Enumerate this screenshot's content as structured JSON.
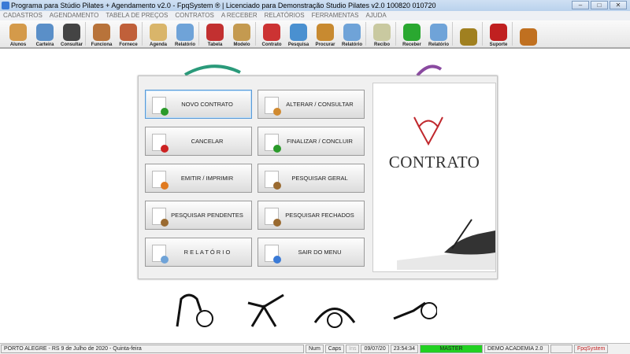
{
  "window": {
    "title": "Programa para Stúdio Pilates + Agendamento v2.0 - FpqSystem ® | Licenciado para  Demonstração Studio Pilates v2.0 100820 010720",
    "minimize": "–",
    "maximize": "□",
    "close": "✕"
  },
  "menu": [
    "CADASTROS",
    "AGENDAMENTO",
    "TABELA DE PREÇOS",
    "CONTRATOS",
    "A RECEBER",
    "RELATÓRIOS",
    "FERRAMENTAS",
    "AJUDA"
  ],
  "toolbar": [
    {
      "label": "Alunos",
      "color": "#d49a4a"
    },
    {
      "label": "Carteira",
      "color": "#5a8fc8"
    },
    {
      "label": "Consultar",
      "color": "#444"
    },
    {
      "sep": true
    },
    {
      "label": "Funciona",
      "color": "#b8733a"
    },
    {
      "label": "Fornece",
      "color": "#c0603a"
    },
    {
      "sep": true
    },
    {
      "label": "Agenda",
      "color": "#d9b56a"
    },
    {
      "label": "Relatório",
      "color": "#6fa3d8"
    },
    {
      "sep": true
    },
    {
      "label": "Tabela",
      "color": "#c23030"
    },
    {
      "label": "Modelo",
      "color": "#c49a50"
    },
    {
      "sep": true
    },
    {
      "label": "Contrato",
      "color": "#cc3333"
    },
    {
      "label": "Pesquisa",
      "color": "#4a90d0"
    },
    {
      "label": "Procurar",
      "color": "#c88a30"
    },
    {
      "label": "Relatório",
      "color": "#6fa3d8"
    },
    {
      "sep": true
    },
    {
      "label": "Recibo",
      "color": "#c9c9a0"
    },
    {
      "sep": true
    },
    {
      "label": "Receber",
      "color": "#2aa830"
    },
    {
      "label": "Relatório",
      "color": "#6fa3d8"
    },
    {
      "sep": true
    },
    {
      "label": "",
      "color": "#a08020"
    },
    {
      "sep": true
    },
    {
      "label": "Suporte",
      "color": "#c02020"
    },
    {
      "sep": true
    },
    {
      "label": "",
      "color": "#c07020"
    }
  ],
  "dialog": {
    "buttons": [
      {
        "label": "NOVO CONTRATO",
        "badge": "#2a9a2a"
      },
      {
        "label": "ALTERAR  /  CONSULTAR",
        "badge": "#d08a30"
      },
      {
        "label": "CANCELAR",
        "badge": "#cc2222"
      },
      {
        "label": "FINALIZAR  /  CONCLUIR",
        "badge": "#2a9a2a"
      },
      {
        "label": "EMITIR  /  IMPRIMIR",
        "badge": "#e07a20"
      },
      {
        "label": "PESQUISAR GERAL",
        "badge": "#9a6a30"
      },
      {
        "label": "PESQUISAR PENDENTES",
        "badge": "#9a6a30"
      },
      {
        "label": "PESQUISAR FECHADOS",
        "badge": "#9a6a30"
      },
      {
        "label": "R E L A T Ó R I O",
        "badge": "#6fa3d8"
      },
      {
        "label": "SAIR DO MENU",
        "badge": "#3a7ad6"
      }
    ],
    "brand": "CONTRATO",
    "accent": "#c0282d"
  },
  "status": {
    "location": "PORTO ALEGRE - RS  9 de Julho de 2020 - Quinta-feira",
    "num": "Num",
    "caps": "Caps",
    "ins": "Ins",
    "date": "09/07/20",
    "time": "23:54:34",
    "user": "MASTER",
    "company": "DEMO ACADEMIA 2.0",
    "vendor": "FpqSystem"
  }
}
